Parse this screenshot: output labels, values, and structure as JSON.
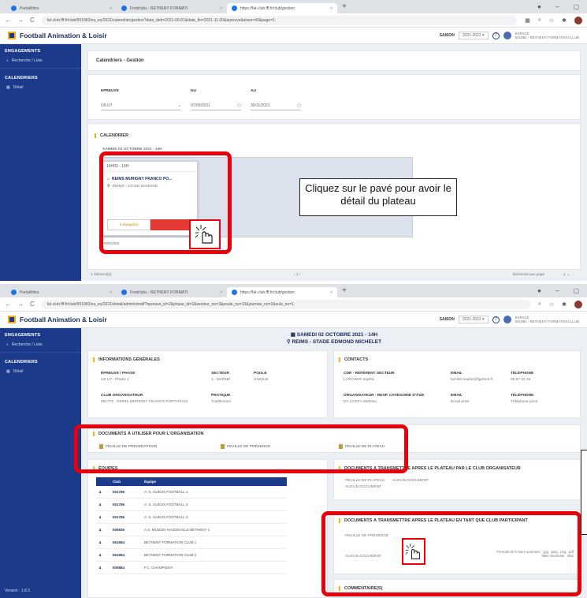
{
  "browser": {
    "tabs": [
      "Portailitites",
      "Footclubs - BETHENY FORMATI",
      "https://fal-club.fff.fr/club/gestion"
    ],
    "url1": "fal-club.fff.fr/club/551983/sa_eu/2021/calendrier/gestion?date_deb=2021-09-01&date_fin=2021-11-30&epreuve&sizes=40&page=1",
    "url2": "fal-club.fff.fr/club/551983/sa_eu/2021/detail/administratif?epreuve_id=2&phase_id=2&secteur_no=3&poule_no=10&journee_no=2&sule_no=1"
  },
  "app": {
    "title": "Football Animation & Loisir",
    "season_label": "SAISON",
    "season_value": "2021-2022",
    "help": "?",
    "club_label": "ESPACE",
    "club_name": "551984 - BETHENY FORMATION CLUB"
  },
  "sidebar": {
    "section1": "ENGAGEMENTS",
    "item1": "Recherche / Liste",
    "section2": "CALENDRIERS",
    "item2": "Détail",
    "version": "Version : 1.8.3"
  },
  "calendar": {
    "breadcrumb": "Calendriers - Gestion",
    "epreuve_label": "EPREUVE",
    "epreuve_value": "U6-U7",
    "du_label": "DU",
    "du_value": "07/09/2021",
    "au_label": "AU",
    "au_value": "30/11/2021",
    "section": "CALENDRIER",
    "subtitle": "SAMEDI 02 OCTOBRE 2021 - 14H",
    "plateau_time": "14H00 - 16H",
    "plateau_club": "REIMS MURIGNY FRANCO PO...",
    "plateau_stade": "REIMS - STADE EDMOND",
    "plateau_btn": "3 équipe(s)",
    "period": "PÉRIODE",
    "pagination": "1 élément(s)",
    "page_nav": "‹  1  ›",
    "per_page": "Éléments par page",
    "per_page_val": "1"
  },
  "callouts": {
    "c1": "Cliquez sur le pavé pour avoir le détail du plateau"
  },
  "detail": {
    "date": "SAMEDI 02 OCTOBRE 2021 - 14H",
    "place": "REIMS - STADE EDMOND MICHELET",
    "info_title": "INFORMATIONS GÉNÉRALES",
    "epreuve_l": "ÉPREUVE / PHASE",
    "epreuve_v": "U6-U7 - Phase 1",
    "secteur_l": "SECTEUR",
    "secteur_v": "1 - MARNE",
    "poule_l": "POULE",
    "poule_v": "UNIQUE",
    "club_l": "CLUB ORGANISATEUR",
    "club_v": "551770 - REIMS MURIGNY FRANCO PORTUGAIS",
    "pratique_l": "PRATIQUE",
    "pratique_v": "Traditionnel",
    "contacts_title": "CONTACTS",
    "cdr_l": "CDR - RÉFÉRENT SECTEUR",
    "cdr_v": "LARCHER Sophie",
    "email_l": "EMAIL",
    "email_v": "larcher.sophie@lgefoot.fr",
    "tel_l": "TÉLÉPHONE",
    "tel_v": "06 87 52 18",
    "org_l": "ORGANISATEUR - RESP. CATÉGORIE D'ÂGE",
    "org_v": "DA COSTA Mathieu",
    "email2_v": "Email privé",
    "tel2_v": "Téléphone privé",
    "docs_title": "DOCUMENTS À UTILISER POUR L'ORGANISATION",
    "doc1": "FEUILLE DE PRÉSENTATION",
    "doc2": "FEUILLE DE PRÉSENCE",
    "doc3": "FEUILLE DE PLATEAU",
    "equipes_title": "ÉQUIPES",
    "col_club": "Club",
    "col_equipe": "Équipe",
    "rows": [
      {
        "num": "501786",
        "name": "A. S. GUEUX FOOTBALL 1"
      },
      {
        "num": "501786",
        "name": "A. S. GUEUX FOOTBALL 2"
      },
      {
        "num": "501786",
        "name": "A. S. GUEUX FOOTBALL 3"
      },
      {
        "num": "505836",
        "name": "A.S. MUIZON HAUDEVILLE-BÉTHENY 1"
      },
      {
        "num": "551984",
        "name": "BETHENY FORMATION CLUB 1"
      },
      {
        "num": "551984",
        "name": "BETHENY FORMATION CLUB 2"
      },
      {
        "num": "500884",
        "name": "F.C. CHAMPIGNY"
      }
    ],
    "trans_org_title": "DOCUMENTS À TRANSMETTRE APRÈS LE PLATEAU PAR LE CLUB ORGANISATEUR",
    "trans_org_1": "FEUILLE DE PLATEAU",
    "trans_org_2": "AUCUN DOCUMENT",
    "trans_org_3": "AUCUN DOCUMENT",
    "trans_part_title": "DOCUMENTS À TRANSMETTRE APRÈS LE PLATEAU EN TANT QUE CLUB PARTICIPANT",
    "trans_part_1": "FEUILLE DE PRÉSENCE",
    "trans_part_2": "AUCUN DOCUMENT",
    "trans_part_fmt": "Formats de fichiers autorisés : .jpg, .jpeg, .png, .pdf",
    "trans_part_size": "Taille maximale : 2Mo",
    "comments_title": "COMMENTAIRE(S)"
  }
}
